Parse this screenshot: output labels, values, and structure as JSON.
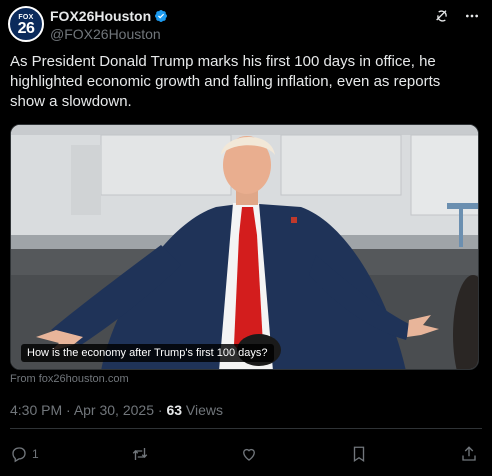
{
  "account": {
    "display_name": "FOX26Houston",
    "handle": "@FOX26Houston",
    "avatar_text_top": "FOX",
    "avatar_text_num": "26",
    "verified": true,
    "verified_color": "#1d9bf0"
  },
  "header_icons": [
    "grok-icon",
    "more-icon"
  ],
  "tweet": {
    "text": "As President Donald Trump marks his first 100 days in office, he highlighted economic growth and falling inflation, even as reports show a slowdown."
  },
  "media": {
    "caption": "How is the economy after Trump's first 100 days?",
    "source": "From fox26houston.com"
  },
  "meta": {
    "time": "4:30 PM",
    "separator": " · ",
    "date": "Apr 30, 2025",
    "views_count": "63",
    "views_label": " Views"
  },
  "actions": {
    "reply_count": "1",
    "icons": [
      "reply-icon",
      "repost-icon",
      "like-icon",
      "bookmark-icon",
      "share-icon"
    ]
  },
  "colors": {
    "background": "#000000",
    "text": "#e7e9ea",
    "muted": "#71767b",
    "border": "#2f3336"
  }
}
